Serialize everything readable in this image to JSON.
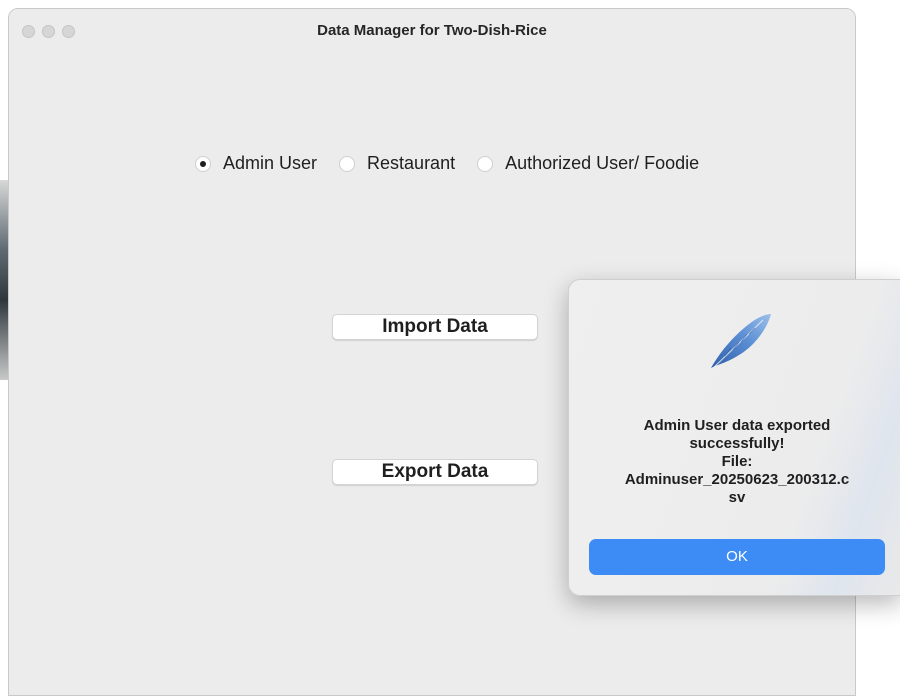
{
  "window": {
    "title": "Data Manager for Two-Dish-Rice"
  },
  "user_type": {
    "options": [
      {
        "label": "Admin User",
        "checked": true
      },
      {
        "label": "Restaurant",
        "checked": false
      },
      {
        "label": "Authorized User/ Foodie",
        "checked": false
      }
    ]
  },
  "actions": {
    "import_label": "Import Data",
    "export_label": "Export Data"
  },
  "alert": {
    "icon": "feather-icon",
    "lines": [
      "Admin User data exported",
      "successfully!",
      "File:",
      "Adminuser_20250623_200312.c",
      "sv"
    ],
    "ok_label": "OK"
  },
  "colors": {
    "accent": "#3d8cf5",
    "window_bg": "#ececec"
  }
}
